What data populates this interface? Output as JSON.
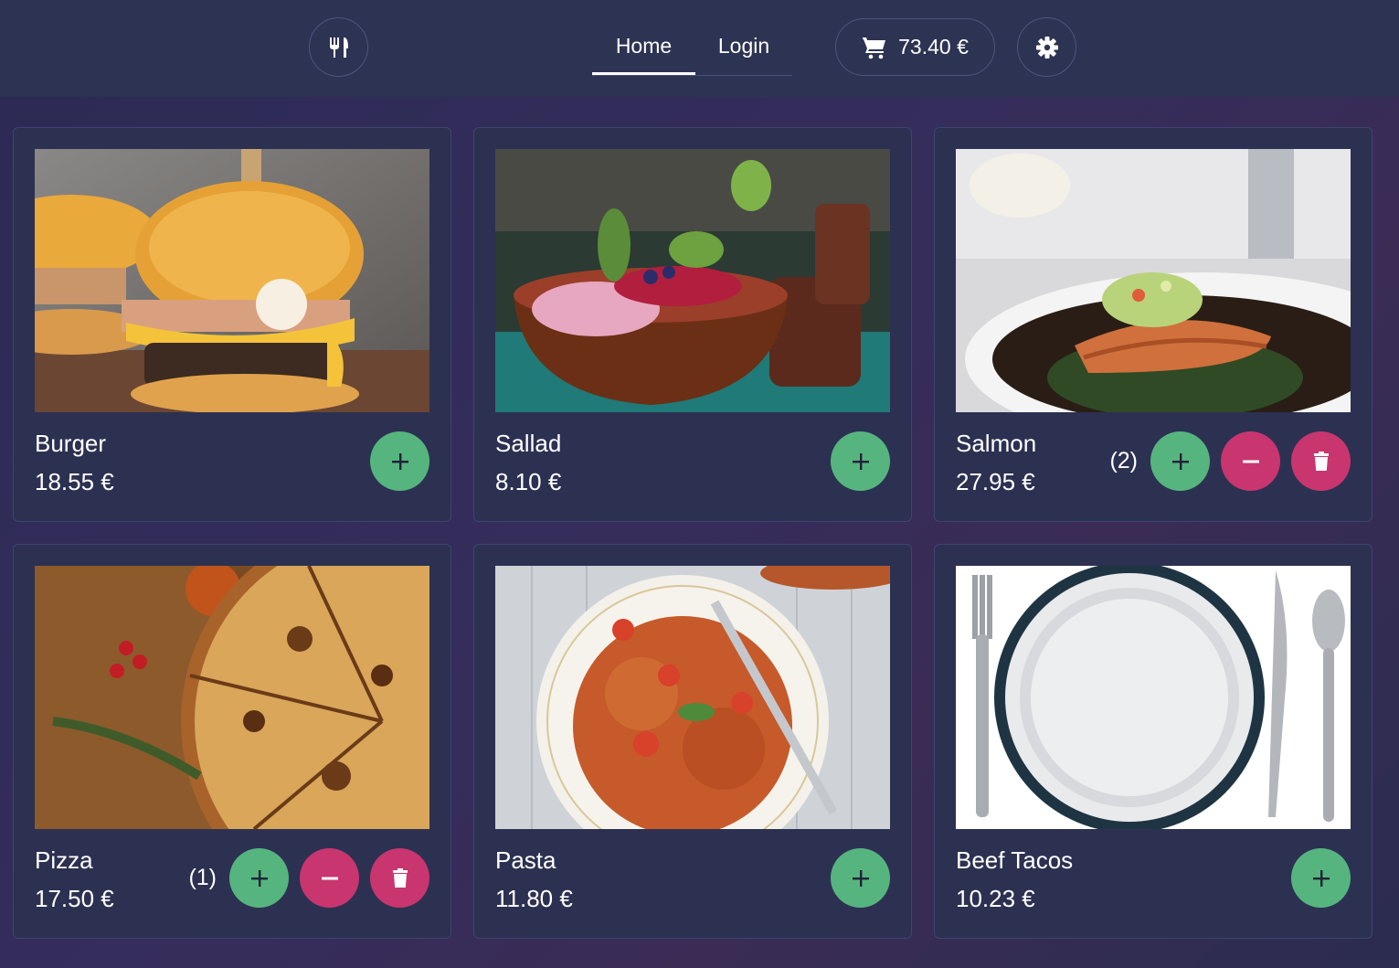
{
  "header": {
    "logo_icon": "utensils-icon",
    "nav": {
      "home": "Home",
      "login": "Login"
    },
    "cart": {
      "icon": "cart-icon",
      "total": "73.40 €"
    },
    "settings_icon": "gear-icon"
  },
  "colors": {
    "add": "#56b57e",
    "remove": "#c8356f",
    "card": "#2c3152",
    "header": "#2d3352"
  },
  "items": [
    {
      "name": "Burger",
      "price": "18.55 €",
      "qty": ""
    },
    {
      "name": "Sallad",
      "price": "8.10 €",
      "qty": ""
    },
    {
      "name": "Salmon",
      "price": "27.95 €",
      "qty": "(2)"
    },
    {
      "name": "Pizza",
      "price": "17.50 €",
      "qty": "(1)"
    },
    {
      "name": "Pasta",
      "price": "11.80 €",
      "qty": ""
    },
    {
      "name": "Beef Tacos",
      "price": "10.23 €",
      "qty": ""
    }
  ]
}
